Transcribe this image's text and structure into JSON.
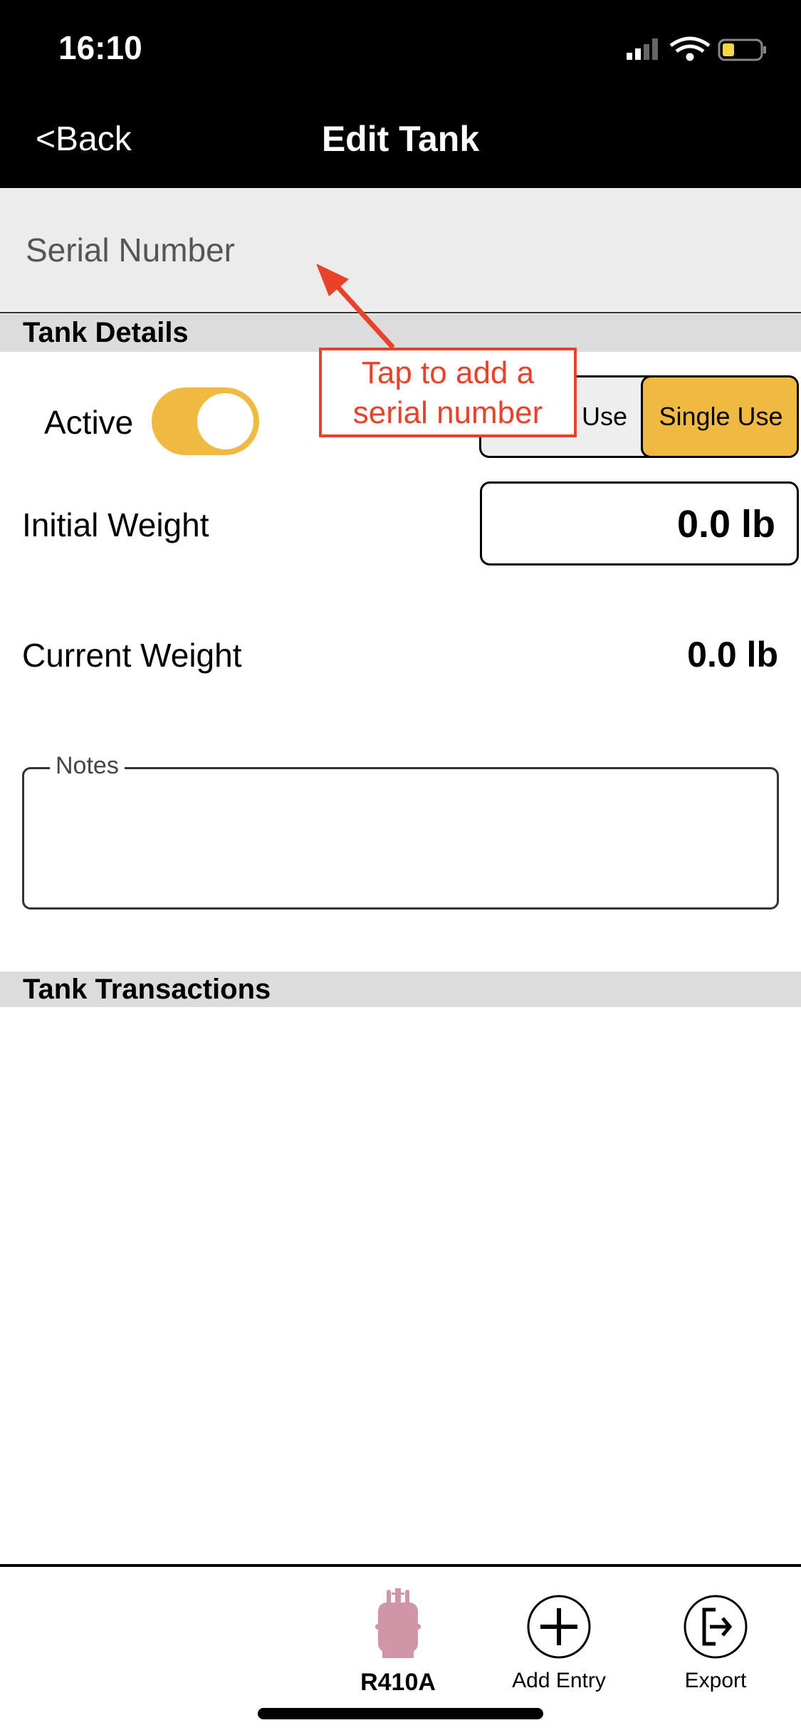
{
  "status_bar": {
    "time": "16:10"
  },
  "nav": {
    "back": "<Back",
    "title": "Edit Tank"
  },
  "serial": {
    "placeholder": "Serial Number"
  },
  "tank_details": {
    "header": "Tank Details",
    "active_label": "Active",
    "active_on": true,
    "segment": {
      "options": [
        "Multi Use",
        "Single Use"
      ],
      "visible_left": "Use",
      "selected": "Single Use"
    },
    "initial_weight_label": "Initial Weight",
    "initial_weight": "0.0 lb",
    "current_weight_label": "Current Weight",
    "current_weight": "0.0 lb",
    "notes_label": "Notes",
    "notes_value": ""
  },
  "transactions": {
    "header": "Tank Transactions"
  },
  "callout": {
    "line1": "Tap to add a",
    "line2": "serial number"
  },
  "toolbar": {
    "refrigerant": "R410A",
    "add_entry": "Add Entry",
    "export": "Export"
  },
  "colors": {
    "accent": "#f0b942",
    "annotation": "#e8432a",
    "tank_icon": "#d195a8"
  }
}
